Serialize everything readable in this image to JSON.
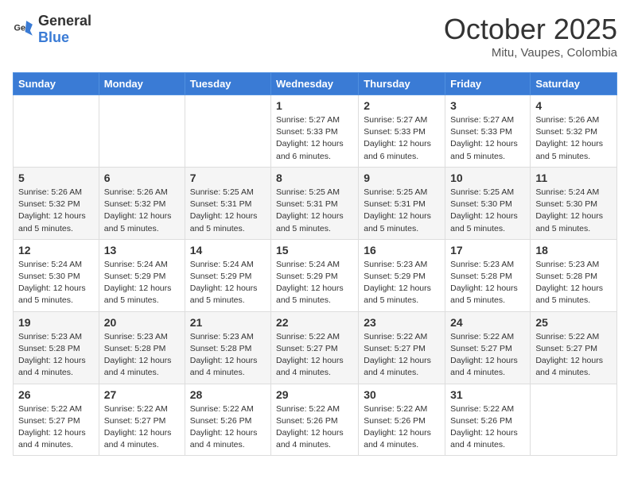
{
  "header": {
    "logo_general": "General",
    "logo_blue": "Blue",
    "month": "October 2025",
    "location": "Mitu, Vaupes, Colombia"
  },
  "weekdays": [
    "Sunday",
    "Monday",
    "Tuesday",
    "Wednesday",
    "Thursday",
    "Friday",
    "Saturday"
  ],
  "weeks": [
    [
      {
        "day": "",
        "info": ""
      },
      {
        "day": "",
        "info": ""
      },
      {
        "day": "",
        "info": ""
      },
      {
        "day": "1",
        "info": "Sunrise: 5:27 AM\nSunset: 5:33 PM\nDaylight: 12 hours\nand 6 minutes."
      },
      {
        "day": "2",
        "info": "Sunrise: 5:27 AM\nSunset: 5:33 PM\nDaylight: 12 hours\nand 6 minutes."
      },
      {
        "day": "3",
        "info": "Sunrise: 5:27 AM\nSunset: 5:33 PM\nDaylight: 12 hours\nand 5 minutes."
      },
      {
        "day": "4",
        "info": "Sunrise: 5:26 AM\nSunset: 5:32 PM\nDaylight: 12 hours\nand 5 minutes."
      }
    ],
    [
      {
        "day": "5",
        "info": "Sunrise: 5:26 AM\nSunset: 5:32 PM\nDaylight: 12 hours\nand 5 minutes."
      },
      {
        "day": "6",
        "info": "Sunrise: 5:26 AM\nSunset: 5:32 PM\nDaylight: 12 hours\nand 5 minutes."
      },
      {
        "day": "7",
        "info": "Sunrise: 5:25 AM\nSunset: 5:31 PM\nDaylight: 12 hours\nand 5 minutes."
      },
      {
        "day": "8",
        "info": "Sunrise: 5:25 AM\nSunset: 5:31 PM\nDaylight: 12 hours\nand 5 minutes."
      },
      {
        "day": "9",
        "info": "Sunrise: 5:25 AM\nSunset: 5:31 PM\nDaylight: 12 hours\nand 5 minutes."
      },
      {
        "day": "10",
        "info": "Sunrise: 5:25 AM\nSunset: 5:30 PM\nDaylight: 12 hours\nand 5 minutes."
      },
      {
        "day": "11",
        "info": "Sunrise: 5:24 AM\nSunset: 5:30 PM\nDaylight: 12 hours\nand 5 minutes."
      }
    ],
    [
      {
        "day": "12",
        "info": "Sunrise: 5:24 AM\nSunset: 5:30 PM\nDaylight: 12 hours\nand 5 minutes."
      },
      {
        "day": "13",
        "info": "Sunrise: 5:24 AM\nSunset: 5:29 PM\nDaylight: 12 hours\nand 5 minutes."
      },
      {
        "day": "14",
        "info": "Sunrise: 5:24 AM\nSunset: 5:29 PM\nDaylight: 12 hours\nand 5 minutes."
      },
      {
        "day": "15",
        "info": "Sunrise: 5:24 AM\nSunset: 5:29 PM\nDaylight: 12 hours\nand 5 minutes."
      },
      {
        "day": "16",
        "info": "Sunrise: 5:23 AM\nSunset: 5:29 PM\nDaylight: 12 hours\nand 5 minutes."
      },
      {
        "day": "17",
        "info": "Sunrise: 5:23 AM\nSunset: 5:28 PM\nDaylight: 12 hours\nand 5 minutes."
      },
      {
        "day": "18",
        "info": "Sunrise: 5:23 AM\nSunset: 5:28 PM\nDaylight: 12 hours\nand 5 minutes."
      }
    ],
    [
      {
        "day": "19",
        "info": "Sunrise: 5:23 AM\nSunset: 5:28 PM\nDaylight: 12 hours\nand 4 minutes."
      },
      {
        "day": "20",
        "info": "Sunrise: 5:23 AM\nSunset: 5:28 PM\nDaylight: 12 hours\nand 4 minutes."
      },
      {
        "day": "21",
        "info": "Sunrise: 5:23 AM\nSunset: 5:28 PM\nDaylight: 12 hours\nand 4 minutes."
      },
      {
        "day": "22",
        "info": "Sunrise: 5:22 AM\nSunset: 5:27 PM\nDaylight: 12 hours\nand 4 minutes."
      },
      {
        "day": "23",
        "info": "Sunrise: 5:22 AM\nSunset: 5:27 PM\nDaylight: 12 hours\nand 4 minutes."
      },
      {
        "day": "24",
        "info": "Sunrise: 5:22 AM\nSunset: 5:27 PM\nDaylight: 12 hours\nand 4 minutes."
      },
      {
        "day": "25",
        "info": "Sunrise: 5:22 AM\nSunset: 5:27 PM\nDaylight: 12 hours\nand 4 minutes."
      }
    ],
    [
      {
        "day": "26",
        "info": "Sunrise: 5:22 AM\nSunset: 5:27 PM\nDaylight: 12 hours\nand 4 minutes."
      },
      {
        "day": "27",
        "info": "Sunrise: 5:22 AM\nSunset: 5:27 PM\nDaylight: 12 hours\nand 4 minutes."
      },
      {
        "day": "28",
        "info": "Sunrise: 5:22 AM\nSunset: 5:26 PM\nDaylight: 12 hours\nand 4 minutes."
      },
      {
        "day": "29",
        "info": "Sunrise: 5:22 AM\nSunset: 5:26 PM\nDaylight: 12 hours\nand 4 minutes."
      },
      {
        "day": "30",
        "info": "Sunrise: 5:22 AM\nSunset: 5:26 PM\nDaylight: 12 hours\nand 4 minutes."
      },
      {
        "day": "31",
        "info": "Sunrise: 5:22 AM\nSunset: 5:26 PM\nDaylight: 12 hours\nand 4 minutes."
      },
      {
        "day": "",
        "info": ""
      }
    ]
  ]
}
